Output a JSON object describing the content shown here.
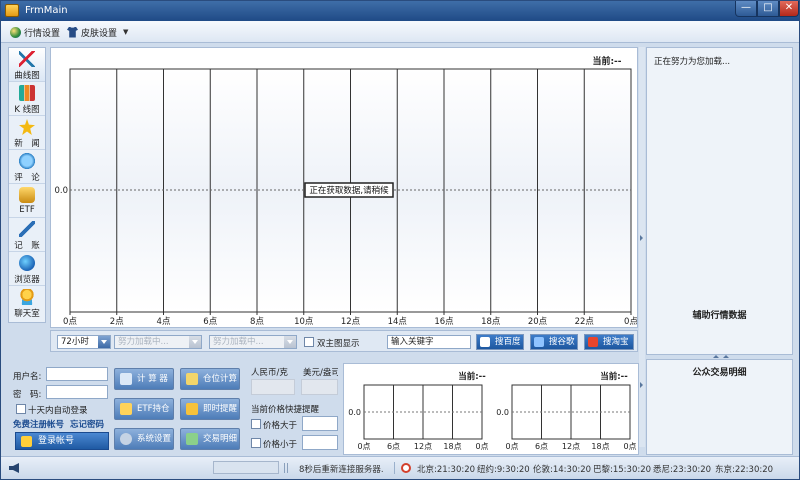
{
  "window": {
    "title": "FrmMain",
    "min": "—",
    "max": "□",
    "close": "✕"
  },
  "menu": {
    "market_settings": "行情设置",
    "skin_settings": "皮肤设置"
  },
  "nav": [
    {
      "label": "曲线图",
      "icon": "curve-chart-icon"
    },
    {
      "label": "K 线图",
      "icon": "kline-chart-icon"
    },
    {
      "label": "新　闻",
      "icon": "star-icon"
    },
    {
      "label": "评　论",
      "icon": "comment-bubble-icon"
    },
    {
      "label": "ETF",
      "icon": "coin-stack-icon"
    },
    {
      "label": "记　账",
      "icon": "pen-icon"
    },
    {
      "label": "浏览器",
      "icon": "browser-globe-icon"
    },
    {
      "label": "聊天室",
      "icon": "chat-user-icon"
    }
  ],
  "main_chart": {
    "current_label": "当前:--",
    "y_value": "0.0",
    "loading_msg": "正在获取数据,请稍候",
    "x_ticks": [
      "0点",
      "2点",
      "4点",
      "6点",
      "8点",
      "10点",
      "12点",
      "14点",
      "16点",
      "18点",
      "20点",
      "22点",
      "0点"
    ]
  },
  "chart_toolbar": {
    "period": "72小时",
    "combo2": "努力加载中...",
    "combo3": "努力加载中...",
    "dual_chart": "双主图显示",
    "keyword_placeholder": "输入关键字",
    "baidu": "搜百度",
    "google": "搜谷歌",
    "taobao": "搜淘宝"
  },
  "right": {
    "loading": "正在努力为您加载...",
    "assist": "辅助行情数据",
    "public_trades": "公众交易明细"
  },
  "login": {
    "user_label": "用户名:",
    "pwd_label": "密　码:",
    "auto_login": "十天内自动登录",
    "register": "免费注册帐号",
    "forgot": "忘记密码",
    "login_btn": "登录帐号"
  },
  "tools": {
    "calculator": "计 算 器",
    "position_calc": "仓位计算",
    "etf_holdings": "ETF持仓",
    "instant_alert": "即时提醒",
    "system_settings": "系统设置",
    "trade_details": "交易明细"
  },
  "price": {
    "rmb_per_gram": "人民币/克",
    "usd_per_oz": "美元/盎司",
    "quick_alert": "当前价格快捷提醒",
    "above": "价格大于",
    "below": "价格小于"
  },
  "mini_charts": [
    {
      "current": "当前:--",
      "y": "0.0",
      "ticks": [
        "0点",
        "6点",
        "12点",
        "18点",
        "0点"
      ]
    },
    {
      "current": "当前:--",
      "y": "0.0",
      "ticks": [
        "0点",
        "6点",
        "12点",
        "18点",
        "0点"
      ]
    }
  ],
  "status": {
    "reconnect": "8秒后重新连接服务器.",
    "beijing": "北京:21:30:20",
    "newyork": "纽约:9:30:20",
    "london": "伦敦:14:30:20",
    "paris": "巴黎:15:30:20",
    "sydney": "悉尼:23:30:20",
    "tokyo": "东京:22:30:20"
  },
  "colors": {
    "accent": "#1f5aa3",
    "titlebar": "#2d5a95",
    "close": "#c0392b"
  }
}
